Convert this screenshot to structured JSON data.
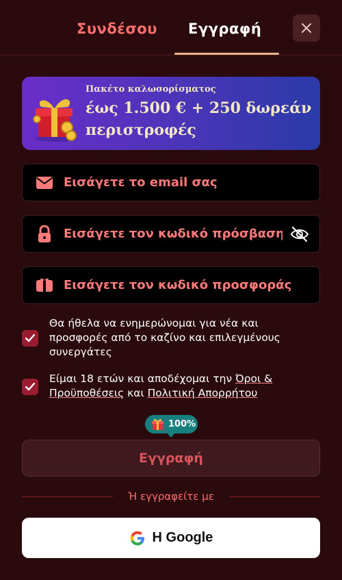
{
  "tabs": {
    "login_label": "Συνδέσου",
    "register_label": "Εγγραφή",
    "active": "register"
  },
  "close": {
    "icon": "close-icon"
  },
  "banner": {
    "subtitle": "Πακέτο καλωσορίσματος",
    "headline": "έως 1.500 € + 250 δωρεάν περιστροφές",
    "icon": "gift-box-coins-icon"
  },
  "form": {
    "email": {
      "placeholder": "Εισάγετε το email σας",
      "value": "",
      "icon": "envelope-icon"
    },
    "password": {
      "placeholder": "Εισάγετε τον κωδικό πρόσβασης",
      "value": "",
      "icon": "lock-icon",
      "toggle_icon": "eye-slash-icon"
    },
    "promo": {
      "placeholder": "Εισάγετε τον κωδικό προσφοράς",
      "value": "",
      "icon": "ticket-icon"
    }
  },
  "consents": {
    "newsletter": {
      "checked": true,
      "text": "Θα ήθελα να ενημερώνομαι για νέα και προσφορές από το καζίνο και επιλεγμένους συνεργάτες"
    },
    "terms": {
      "checked": true,
      "prefix": "Είμαι 18 ετών και αποδέχομαι την ",
      "terms_link": "Όροι & Προϋποθέσεις",
      "middle": " και ",
      "privacy_link": "Πολιτική Απορρήτου"
    }
  },
  "progress": {
    "percent_label": "100%",
    "percent": 100,
    "icon": "gift-icon"
  },
  "submit": {
    "label": "Εγγραφή"
  },
  "alt_signup": {
    "divider_text": "Ή εγγραφείτε με",
    "google_label": "Η Google",
    "google_icon": "google-icon"
  },
  "colors": {
    "background": "#2a0a0d",
    "accent_red": "#ff6f6f",
    "checkbox": "#9a1c31",
    "banner_start": "#6a2ec8",
    "banner_end": "#2a3aa8",
    "pill": "#17807f",
    "tab_underline": "#e9b58b"
  }
}
